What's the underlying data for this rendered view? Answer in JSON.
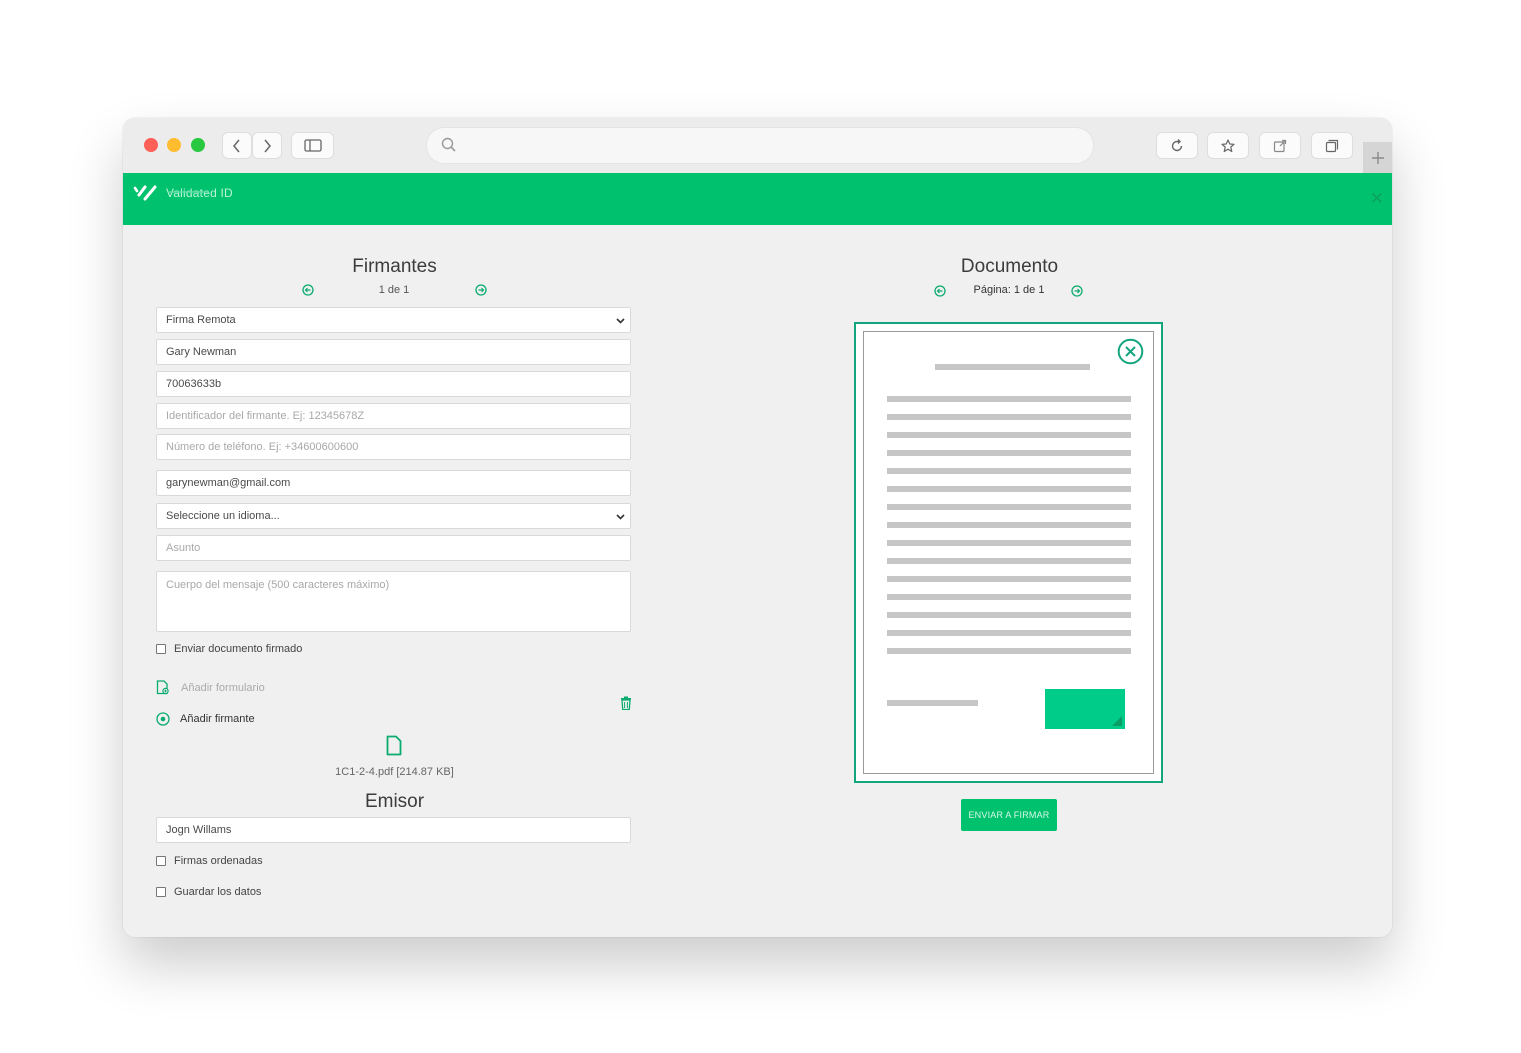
{
  "app": {
    "brand": "Validated ID",
    "accent_color": "#00c26e",
    "accent_dark": "#13a57d"
  },
  "browser": {
    "icons": [
      "back-icon",
      "forward-icon",
      "sidebar-icon",
      "search-icon",
      "reload-icon",
      "star-icon",
      "share-icon",
      "tabs-icon",
      "plus-icon"
    ]
  },
  "signers": {
    "title": "Firmantes",
    "pager": "1 de 1",
    "signature_type": "Firma Remota",
    "name_value": "Gary Newman",
    "id_value": "70063633b",
    "identifier_placeholder": "Identificador del firmante. Ej: 12345678Z",
    "phone_placeholder": "Número de teléfono. Ej: +34600600600",
    "email_value": "garynewman@gmail.com",
    "language_select": "Seleccione un idioma...",
    "subject_placeholder": "Asunto",
    "body_placeholder": "Cuerpo del mensaje (500 caracteres máximo)",
    "send_signed_label": "Enviar documento firmado",
    "add_form_label": "Añadir formulario",
    "add_signer_label": "Añadir firmante",
    "file_label": "1C1-2-4.pdf [214.87 KB]"
  },
  "issuer": {
    "title": "Emisor",
    "name_value": "Jogn Willams",
    "ordered_label": "Firmas ordenadas",
    "save_label": "Guardar los datos"
  },
  "document": {
    "title": "Documento",
    "page_info": "Página: 1 de 1",
    "send_button": "ENVIAR A FIRMAR"
  }
}
